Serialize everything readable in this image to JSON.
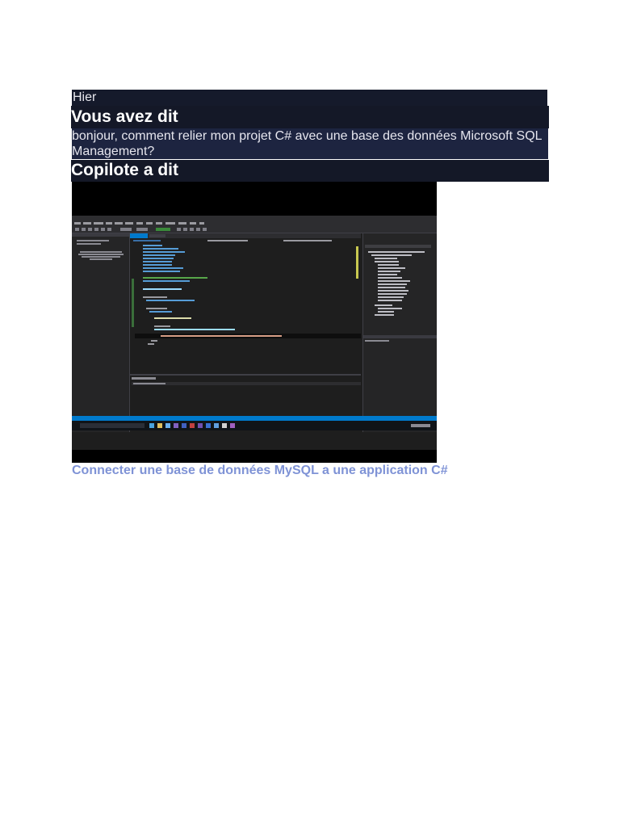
{
  "history": {
    "day_label": "Hier"
  },
  "conversation": {
    "user_heading": "Vous avez dit",
    "user_message": "bonjour, comment relier mon projet C# avec une base des données Microsoft SQL Management?",
    "copilot_heading": "Copilote a dit"
  },
  "result": {
    "video_thumbnail_icon": "visual-studio-screenshot",
    "link_text": "Connecter une base de données MySQL a une application C#"
  },
  "colors": {
    "band_bg": "#151a2b",
    "message_bg": "#1d2440",
    "link": "#7f93d6",
    "vs_accent": "#007acc"
  }
}
